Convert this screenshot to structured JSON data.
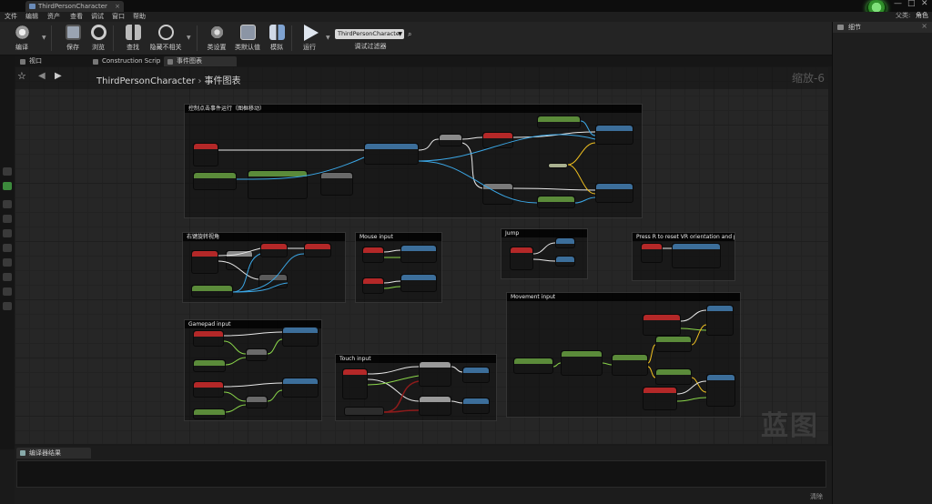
{
  "window": {
    "tab_title": "ThirdPersonCharacter",
    "controls": {
      "minimize": "—",
      "maximize": "□",
      "close": "✕"
    }
  },
  "menu": {
    "items": [
      "文件",
      "编辑",
      "资产",
      "查看",
      "调试",
      "窗口",
      "帮助"
    ],
    "right_label": "父类:",
    "right_value": "角色"
  },
  "toolbar": {
    "buttons": [
      {
        "label": "编译",
        "icon": "gear-compile-icon"
      },
      {
        "label": "保存",
        "icon": "save-icon"
      },
      {
        "label": "浏览",
        "icon": "browse-icon"
      },
      {
        "label": "查找",
        "icon": "binoculars-icon"
      },
      {
        "label": "隐藏不相关",
        "icon": "hide-unrelated-icon"
      },
      {
        "label": "类设置",
        "icon": "class-settings-icon"
      },
      {
        "label": "类默认值",
        "icon": "class-defaults-icon"
      },
      {
        "label": "模拟",
        "icon": "simulation-icon"
      },
      {
        "label": "运行",
        "icon": "play-icon"
      }
    ],
    "debug_object": "ThirdPersonCharacter",
    "debug_label": "调试过滤器"
  },
  "editor_tabs": [
    {
      "label": "视口",
      "icon": "viewport-icon"
    },
    {
      "label": "Construction Scrip",
      "icon": "function-icon"
    },
    {
      "label": "事件图表",
      "icon": "event-graph-icon"
    }
  ],
  "details_panel": {
    "title": "细节"
  },
  "graph": {
    "breadcrumb_root": "ThirdPersonCharacter",
    "breadcrumb_current": "事件图表",
    "zoom": "缩放-6",
    "watermark": "蓝图",
    "comments": [
      "控制点击事件运行（图框移动）",
      "右键旋转视角",
      "Mouse input",
      "Jump",
      "Press R to reset VR orientation and position",
      "Movement input",
      "Gamepad input",
      "Touch input"
    ]
  },
  "compiler_results": {
    "tab": "编译器结果",
    "clear": "清除"
  },
  "colors": {
    "event_node": "#b42828",
    "function_node": "#3c6e9a",
    "pure_node": "#5b8b3a",
    "branch_node": "#8a8a8a",
    "exec_wire": "#e8e8e8",
    "object_wire": "#3ba7e6",
    "vector_wire": "#f0c020",
    "bool_wire": "#8e1b1b",
    "float_wire": "#8ad64a"
  }
}
